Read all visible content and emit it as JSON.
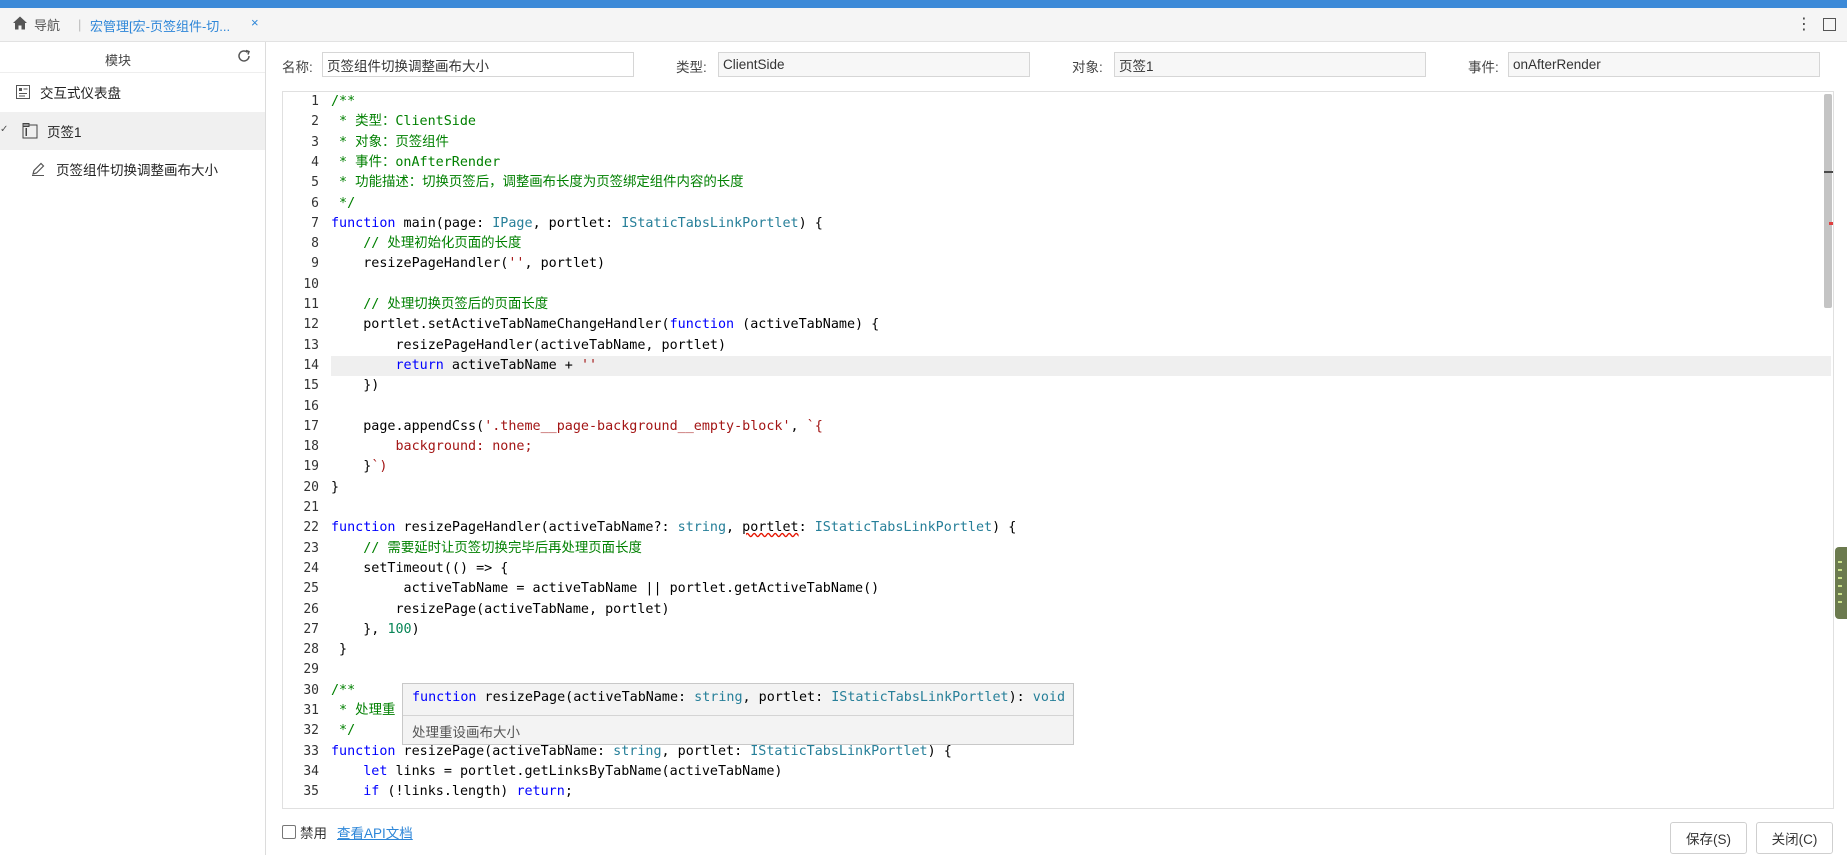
{
  "topbar": {
    "home_label": "导航",
    "active_tab": "宏管理[宏-页签组件-切...",
    "close_glyph": "×"
  },
  "sidebar": {
    "title": "模块",
    "items": [
      {
        "label": "交互式仪表盘",
        "icon": "dashboard-icon"
      },
      {
        "label": "页签1",
        "icon": "tab-page-icon"
      },
      {
        "label": "页签组件切换调整画布大小",
        "icon": "script-pen-icon"
      }
    ]
  },
  "fields": {
    "name_label": "名称:",
    "name_value": "页签组件切换调整画布大小",
    "type_label": "类型:",
    "type_value": "ClientSide",
    "object_label": "对象:",
    "object_value": "页签1",
    "event_label": "事件:",
    "event_value": "onAfterRender"
  },
  "editor": {
    "line_numbers": [
      "1",
      "2",
      "3",
      "4",
      "5",
      "6",
      "7",
      "8",
      "9",
      "10",
      "11",
      "12",
      "13",
      "14",
      "15",
      "16",
      "17",
      "18",
      "19",
      "20",
      "21",
      "22",
      "23",
      "24",
      "25",
      "26",
      "27",
      "28",
      "29",
      "30",
      "31",
      "32",
      "33",
      "34",
      "35"
    ],
    "lines": [
      "/**",
      " * 类型：ClientSide",
      " * 对象：页签组件",
      " * 事件：onAfterRender",
      " * 功能描述：切换页签后，调整画布长度为页签绑定组件内容的长度",
      " */",
      "function main(page: IPage, portlet: IStaticTabsLinkPortlet) {",
      "    // 处理初始化页面的长度",
      "    resizePageHandler('', portlet)",
      "",
      "    // 处理切换页签后的页面长度",
      "    portlet.setActiveTabNameChangeHandler(function (activeTabName) {",
      "        resizePageHandler(activeTabName, portlet)",
      "        return activeTabName + ''",
      "    })",
      "",
      "    page.appendCss('.theme__page-background__empty-block', `{",
      "        background: none;",
      "    }`)",
      "}",
      "",
      "function resizePageHandler(activeTabName?: string, portlet: IStaticTabsLinkPortlet) {",
      "    // 需要延时让页签切换完毕后再处理页面长度",
      "    setTimeout(() => {",
      "         activeTabName = activeTabName || portlet.getActiveTabName()",
      "        resizePage(activeTabName, portlet)",
      "    }, 100)",
      " }",
      "",
      "/**",
      " * 处理重",
      " */",
      "function resizePage(activeTabName: string, portlet: IStaticTabsLinkPortlet) {",
      "    let links = portlet.getLinksByTabName(activeTabName)",
      "    if (!links.length) return;"
    ]
  },
  "tooltip": {
    "signature": "function resizePage(activeTabName: string, portlet: IStaticTabsLinkPortlet): void",
    "doc": "处理重设画布大小"
  },
  "footer": {
    "disable_label": "禁用",
    "api_link": "查看API文档",
    "save_button": "保存(S)",
    "close_button": "关闭(C)"
  },
  "colors": {
    "accent": "#2d86d8",
    "top_stripe": "#3c8ad8",
    "keyword": "#0000ff",
    "type": "#267f99",
    "string": "#a31515",
    "comment": "#008000"
  }
}
